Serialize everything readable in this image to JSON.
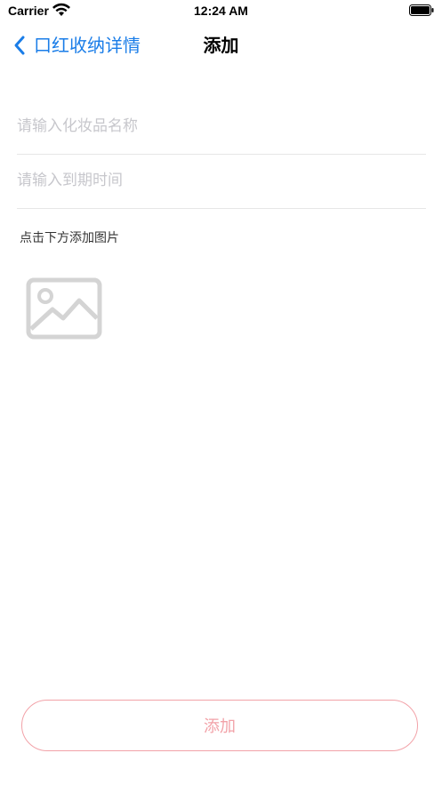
{
  "status_bar": {
    "carrier": "Carrier",
    "time": "12:24 AM",
    "icons": [
      "wifi-icon",
      "battery-icon"
    ]
  },
  "nav": {
    "back_label": "口红收纳详情",
    "title": "添加",
    "back_icon": "chevron-left-icon"
  },
  "form": {
    "name_placeholder": "请输入化妆品名称",
    "name_value": "",
    "date_placeholder": "请输入到期时间",
    "date_value": "",
    "image_hint": "点击下方添加图片",
    "image_icon": "image-placeholder-icon"
  },
  "actions": {
    "add_label": "添加"
  },
  "colors": {
    "accent": "#1a7de8",
    "button": "#f2a2a8",
    "divider": "#e6e6e6",
    "placeholder": "#c7c7cc"
  }
}
